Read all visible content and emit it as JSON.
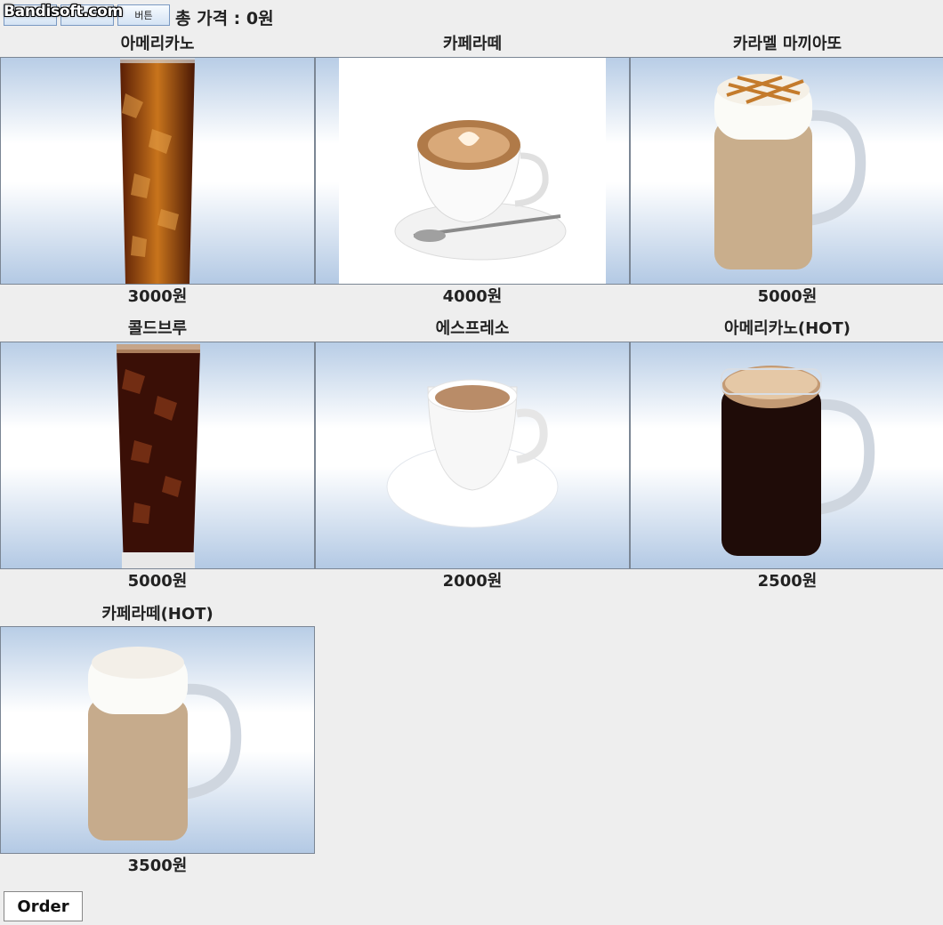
{
  "watermark": "Bandisoft.com",
  "toolbar": {
    "buttons": [
      "",
      "",
      "버튼"
    ],
    "total_label": "총 가격 : 0원"
  },
  "menu": [
    {
      "name": "아메리카노",
      "price": "3000원",
      "icon": "iced-americano-image"
    },
    {
      "name": "카페라떼",
      "price": "4000원",
      "icon": "cafe-latte-image"
    },
    {
      "name": "카라멜 마끼아또",
      "price": "5000원",
      "icon": "caramel-macchiato-image"
    },
    {
      "name": "콜드브루",
      "price": "5000원",
      "icon": "cold-brew-image"
    },
    {
      "name": "에스프레소",
      "price": "2000원",
      "icon": "espresso-image"
    },
    {
      "name": "아메리카노(HOT)",
      "price": "2500원",
      "icon": "hot-americano-image"
    },
    {
      "name": "카페라떼(HOT)",
      "price": "3500원",
      "icon": "hot-latte-image"
    }
  ],
  "order_label": "Order"
}
